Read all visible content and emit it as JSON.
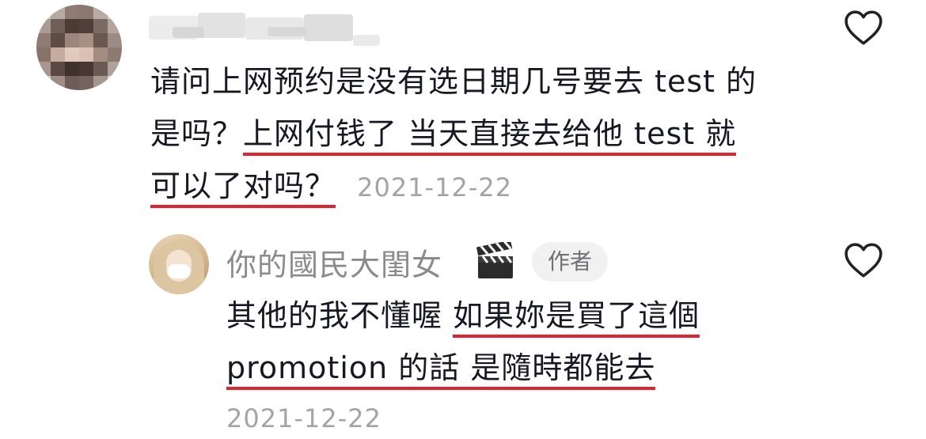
{
  "comment": {
    "text_line1": "请问上网预约是没有选日期几号要去 test 的",
    "text_line2_plain": "是吗？",
    "text_line2_highlight": "上网付钱了 当天直接去给他 test 就",
    "text_line3_highlight": "可以了对吗？",
    "date": "2021-12-22",
    "like_icon": "heart-outline-icon"
  },
  "reply": {
    "username": "你的國民大閨女",
    "username_emoji_icon": "clapperboard-icon",
    "author_badge": "作者",
    "text_line1_plain": "其他的我不懂喔 ",
    "text_line1_highlight": "如果妳是買了這個",
    "text_line2_highlight": "promotion 的話 是隨時都能去",
    "date": "2021-12-22",
    "like_icon": "heart-outline-icon"
  },
  "colors": {
    "text": "#161823",
    "muted": "#a3a4a8",
    "underline": "#e1232e",
    "badge_bg": "#f1f1f2"
  }
}
